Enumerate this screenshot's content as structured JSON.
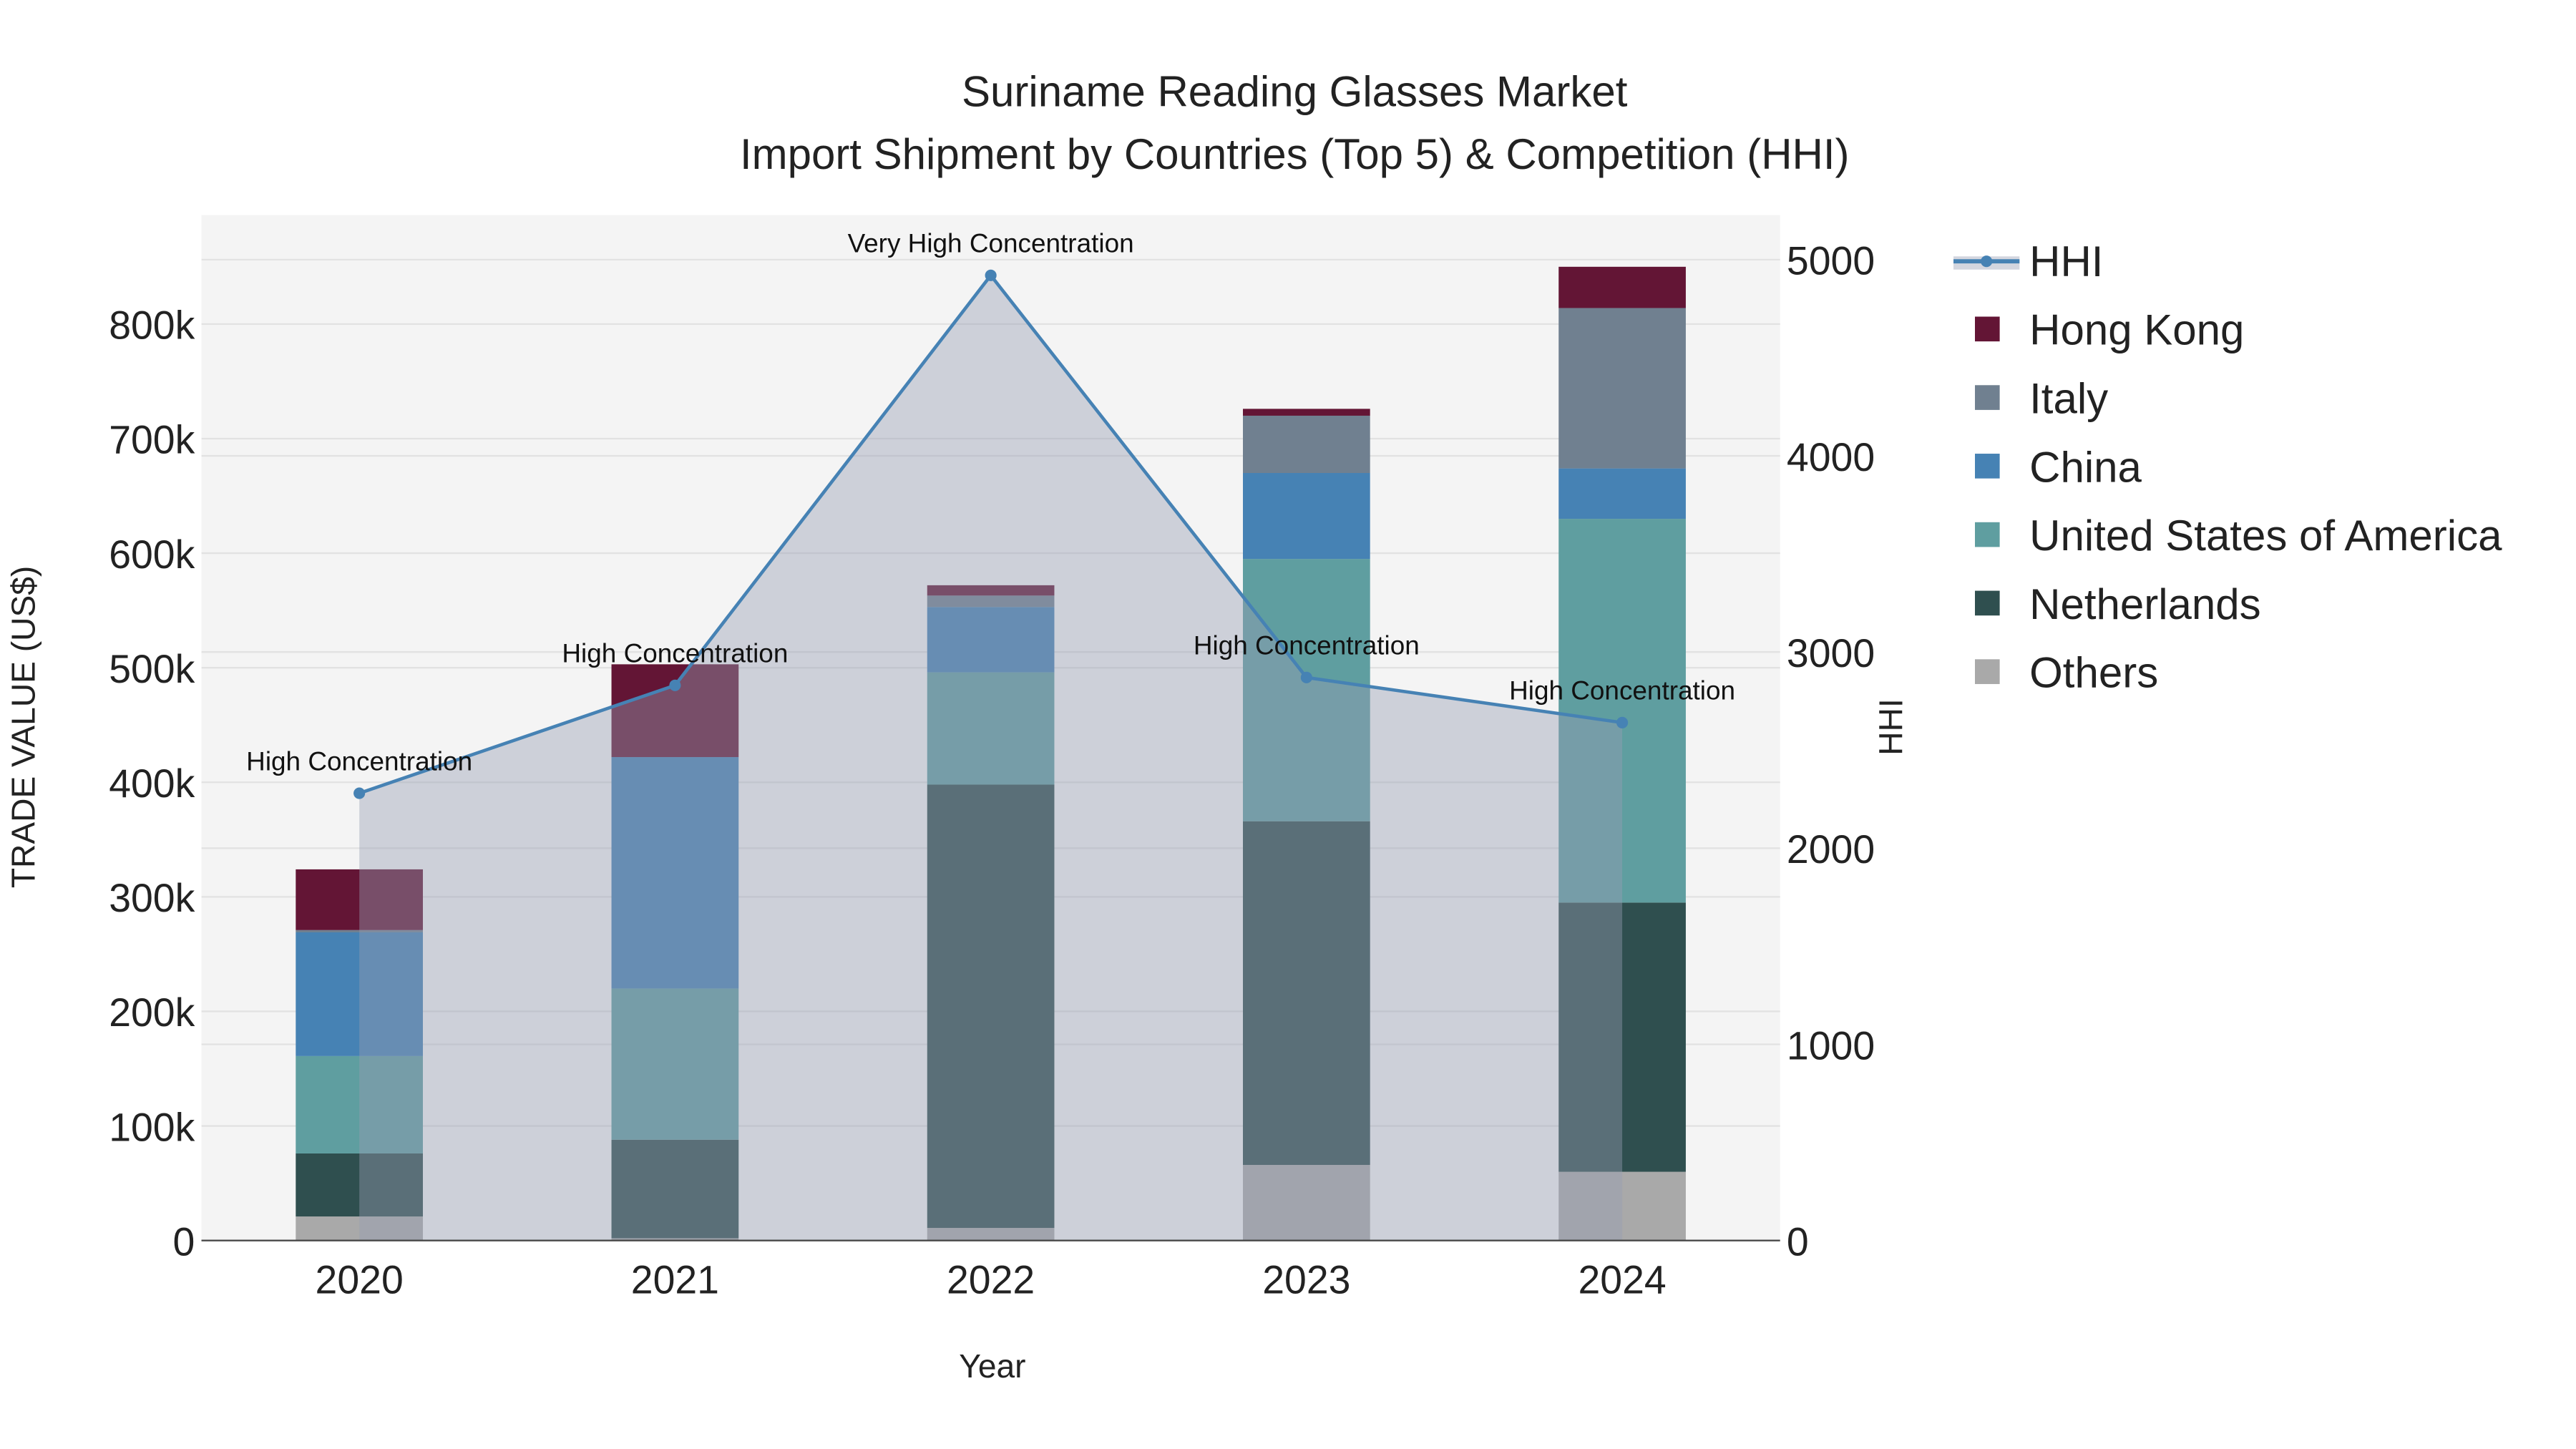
{
  "chart_data": {
    "type": "bar",
    "title": "Suriname Reading Glasses Market",
    "subtitle": "Import Shipment by Countries (Top 5) & Competition (HHI)",
    "xlabel": "Year",
    "ylabel": "TRADE VALUE (US$)",
    "y2label": "HHI",
    "categories": [
      "2020",
      "2021",
      "2022",
      "2023",
      "2024"
    ],
    "ylim": [
      0,
      895000
    ],
    "y2lim": [
      0,
      5200
    ],
    "yticks": [
      0,
      100000,
      200000,
      300000,
      400000,
      500000,
      600000,
      700000,
      800000
    ],
    "ytick_labels": [
      "0",
      "100k",
      "200k",
      "300k",
      "400k",
      "500k",
      "600k",
      "700k",
      "800k"
    ],
    "y2ticks": [
      0,
      1000,
      2000,
      3000,
      4000,
      5000
    ],
    "y2tick_labels": [
      "0",
      "1000",
      "2000",
      "3000",
      "4000",
      "5000"
    ],
    "grid": true,
    "legend_position": "right",
    "series": [
      {
        "name": "Others",
        "color": "#a9a9a9",
        "values": [
          21000,
          2000,
          11000,
          66000,
          60000
        ]
      },
      {
        "name": "Netherlands",
        "color": "#2f4f4f",
        "values": [
          55000,
          86000,
          387000,
          300000,
          235000
        ]
      },
      {
        "name": "United States of America",
        "color": "#5f9ea0",
        "values": [
          85000,
          132000,
          98000,
          229000,
          335000
        ]
      },
      {
        "name": "China",
        "color": "#4682b4",
        "values": [
          108000,
          202000,
          57000,
          75000,
          44000
        ]
      },
      {
        "name": "Italy",
        "color": "#708090",
        "values": [
          2000,
          0,
          10000,
          50000,
          140000
        ]
      },
      {
        "name": "Hong Kong",
        "color": "#631535",
        "values": [
          53000,
          81000,
          9000,
          6000,
          36000
        ]
      }
    ],
    "line": {
      "name": "HHI",
      "color": "#4682b4",
      "values": [
        2280,
        2830,
        4920,
        2870,
        2640
      ],
      "annotations": [
        "High Concentration",
        "High Concentration",
        "Very High Concentration",
        "High Concentration",
        "High Concentration"
      ]
    },
    "legend_order": [
      "HHI",
      "Hong Kong",
      "Italy",
      "China",
      "United States of America",
      "Netherlands",
      "Others"
    ]
  }
}
